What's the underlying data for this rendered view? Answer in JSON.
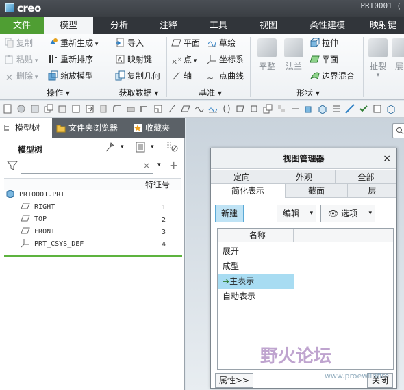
{
  "app": {
    "logo": "creo",
    "document": "PRT0001 ("
  },
  "tabs": [
    "文件",
    "模型",
    "分析",
    "注释",
    "工具",
    "视图",
    "柔性建模",
    "映射键"
  ],
  "ribbon": {
    "operations": {
      "copy": "复制",
      "paste": "粘贴",
      "delete": "删除",
      "regenerate": "重新生成",
      "reorder": "重新排序",
      "scale": "缩放模型",
      "label": "操作"
    },
    "get_data": {
      "import": "导入",
      "mapkey": "映射键",
      "copy_geom": "复制几何",
      "label": "获取数据"
    },
    "datum": {
      "plane": "平面",
      "point": "点",
      "axis": "轴",
      "sketch": "草绘",
      "csys": "坐标系",
      "curve": "点曲线",
      "label": "基准"
    },
    "shapes": {
      "flat": "平整",
      "flange": "法兰",
      "extrude": "拉伸",
      "plane": "平面",
      "blend": "边界混合",
      "label": "形状"
    },
    "editing": {
      "tear": "扯裂",
      "more": "展"
    }
  },
  "left_panel": {
    "tabs": [
      "模型树",
      "文件夹浏览器",
      "收藏夹"
    ],
    "tree_title": "模型树",
    "filter_placeholder": "",
    "feature_col": "特征号",
    "items": [
      {
        "name": "PRT0001.PRT",
        "num": ""
      },
      {
        "name": "RIGHT",
        "num": "1"
      },
      {
        "name": "TOP",
        "num": "2"
      },
      {
        "name": "FRONT",
        "num": "3"
      },
      {
        "name": "PRT_CSYS_DEF",
        "num": "4"
      }
    ]
  },
  "dialog": {
    "title": "视图管理器",
    "close": "×",
    "tabs_row1": [
      "定向",
      "外观",
      "全部"
    ],
    "tabs_row2": [
      "简化表示",
      "截面",
      "层"
    ],
    "new_btn": "新建",
    "edit_btn": "编辑",
    "options_btn": "选项",
    "list_header": "名称",
    "list_items": [
      "展开",
      "成型",
      "主表示",
      "自动表示"
    ],
    "selected_item": "主表示",
    "props_btn": "属性>>",
    "close_btn": "关闭"
  },
  "watermark": {
    "text": "野火论坛",
    "url": "www.proewildfire"
  },
  "colors": {
    "accent_green": "#4f9e33",
    "title_bg": "#3a3e43",
    "selection": "#a8dcf2"
  }
}
